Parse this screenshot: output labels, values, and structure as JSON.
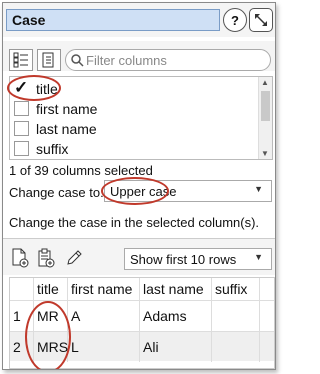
{
  "header": {
    "title": "Case",
    "help_label": "?",
    "expand_label": "↘"
  },
  "filter": {
    "placeholder": "Filter columns"
  },
  "columns": [
    {
      "label": "title",
      "checked": true
    },
    {
      "label": "first name",
      "checked": false
    },
    {
      "label": "last name",
      "checked": false
    },
    {
      "label": "suffix",
      "checked": false
    }
  ],
  "status": "1 of 39 columns selected",
  "change_case": {
    "label": "Change case to:",
    "value": "Upper case"
  },
  "description": "Change the case in the selected column(s).",
  "preview": {
    "rows_option": "Show first 10 rows",
    "headers": [
      "title",
      "first name",
      "last name",
      "suffix"
    ],
    "rows": [
      {
        "num": "1",
        "title": "MR",
        "first": "A",
        "last": "Adams",
        "suffix": ""
      },
      {
        "num": "2",
        "title": "MRS",
        "first": "L",
        "last": "Ali",
        "suffix": ""
      }
    ]
  },
  "colors": {
    "header_bg": "#cfe0f5",
    "annotation": "#c0392b"
  }
}
